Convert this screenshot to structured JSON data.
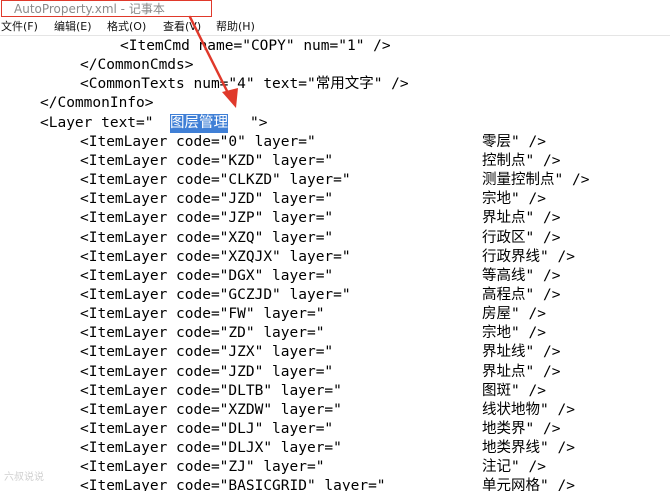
{
  "window": {
    "title": "AutoProperty.xml - 记事本"
  },
  "menu": [
    {
      "label": "文件(F)"
    },
    {
      "label": "编辑(E)"
    },
    {
      "label": "格式(O)"
    },
    {
      "label": "查看(V)"
    },
    {
      "label": "帮助(H)"
    }
  ],
  "editor": {
    "lines": [
      {
        "indent": 12,
        "a": "<ItemCmd name=\"COPY\" num=\"1\" />"
      },
      {
        "indent": 8,
        "a": "</CommonCmds>"
      },
      {
        "indent": 8,
        "a": "<CommonTexts num=\"4\" text=\"常用文字\" />"
      },
      {
        "indent": 4,
        "a": "</CommonInfo>"
      },
      {
        "indent": 4,
        "a": "<Layer text=\"",
        "sel": "图层管理",
        "c": "\">"
      },
      {
        "indent": 8,
        "a": "<ItemLayer code=\"0\" layer=\"",
        "b": "零层\" />"
      },
      {
        "indent": 8,
        "a": "<ItemLayer code=\"KZD\" layer=\"",
        "b": "控制点\" />"
      },
      {
        "indent": 8,
        "a": "<ItemLayer code=\"CLKZD\" layer=\"",
        "b": "测量控制点\" />"
      },
      {
        "indent": 8,
        "a": "<ItemLayer code=\"JZD\" layer=\"",
        "b": "宗地\" />"
      },
      {
        "indent": 8,
        "a": "<ItemLayer code=\"JZP\" layer=\"",
        "b": "界址点\" />"
      },
      {
        "indent": 8,
        "a": "<ItemLayer code=\"XZQ\" layer=\"",
        "b": "行政区\" />"
      },
      {
        "indent": 8,
        "a": "<ItemLayer code=\"XZQJX\" layer=\"",
        "b": "行政界线\" />"
      },
      {
        "indent": 8,
        "a": "<ItemLayer code=\"DGX\" layer=\"",
        "b": "等高线\" />"
      },
      {
        "indent": 8,
        "a": "<ItemLayer code=\"GCZJD\" layer=\"",
        "b": "高程点\" />"
      },
      {
        "indent": 8,
        "a": "<ItemLayer code=\"FW\" layer=\"",
        "b": "房屋\" />"
      },
      {
        "indent": 8,
        "a": "<ItemLayer code=\"ZD\" layer=\"",
        "b": "宗地\" />"
      },
      {
        "indent": 8,
        "a": "<ItemLayer code=\"JZX\" layer=\"",
        "b": "界址线\" />"
      },
      {
        "indent": 8,
        "a": "<ItemLayer code=\"JZD\" layer=\"",
        "b": "界址点\" />"
      },
      {
        "indent": 8,
        "a": "<ItemLayer code=\"DLTB\" layer=\"",
        "b": "图斑\" />"
      },
      {
        "indent": 8,
        "a": "<ItemLayer code=\"XZDW\" layer=\"",
        "b": "线状地物\" />"
      },
      {
        "indent": 8,
        "a": "<ItemLayer code=\"DLJ\" layer=\"",
        "b": "地类界\" />"
      },
      {
        "indent": 8,
        "a": "<ItemLayer code=\"DLJX\" layer=\"",
        "b": "地类界线\" />"
      },
      {
        "indent": 8,
        "a": "<ItemLayer code=\"ZJ\" layer=\"",
        "b": "注记\" />"
      },
      {
        "indent": 8,
        "a": "<ItemLayer code=\"BASICGRID\" layer=\"",
        "b": "单元网格\" />"
      }
    ]
  },
  "watermark": {
    "text": "六叔说说"
  },
  "colors": {
    "selection": "#3f7fd6",
    "annotation": "#e0392b"
  }
}
